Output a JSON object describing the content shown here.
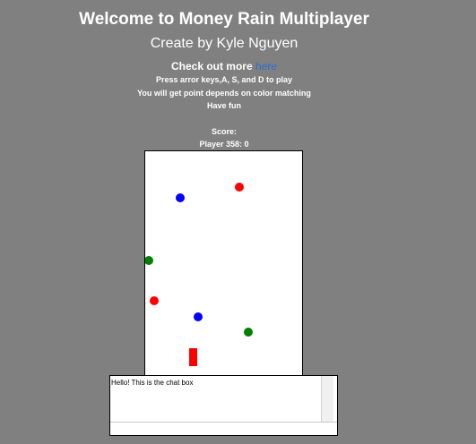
{
  "header": {
    "title": "Welcome to Money Rain Multiplayer",
    "subtitle": "Create by Kyle Nguyen",
    "checkout_prefix": "Check out more",
    "checkout_link": "here",
    "instructions": [
      "Press arror keys,A, S, and D to play",
      "You will get point depends on color matching",
      "Have fun"
    ],
    "score_label": "Score:",
    "player_score": "Player 358: 0"
  },
  "game": {
    "colors": {
      "red": "#ff0000",
      "blue": "#0000ff",
      "green": "#008000",
      "background": "#ffffff"
    },
    "player_paddle_color": "#ff0000"
  },
  "chat": {
    "text": "Hello! This is the chat box"
  }
}
